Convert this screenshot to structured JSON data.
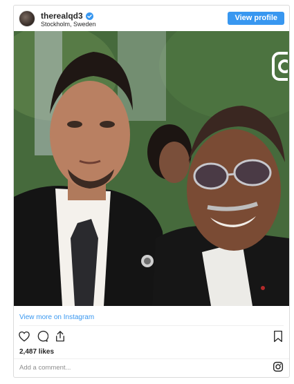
{
  "header": {
    "username": "therealqd3",
    "location": "Stockholm, Sweden",
    "view_profile_label": "View profile"
  },
  "post": {
    "view_more_label": "View more on Instagram",
    "likes": "2,487 likes",
    "comment_placeholder": "Add a comment..."
  },
  "colors": {
    "accent": "#3897f0",
    "text": "#262626",
    "muted": "#8e8e8e",
    "border": "#dbdbdb"
  },
  "icons": [
    "verified-badge-icon",
    "instagram-camera-icon",
    "heart-icon",
    "comment-icon",
    "share-icon",
    "bookmark-icon",
    "instagram-logo-icon"
  ]
}
